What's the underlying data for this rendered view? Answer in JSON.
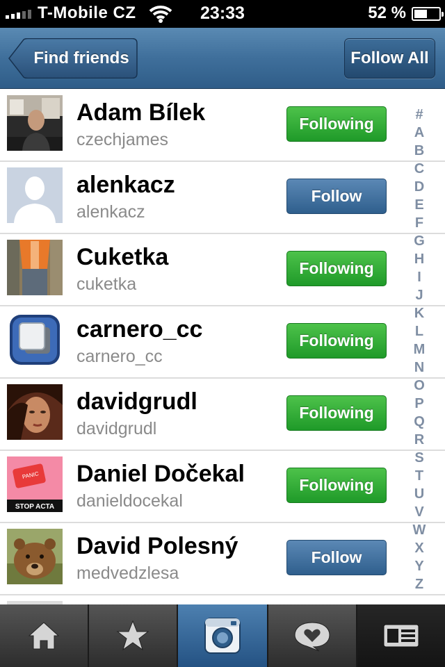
{
  "status": {
    "carrier": "T-Mobile CZ",
    "time": "23:33",
    "battery_text": "52 %",
    "battery_level": 0.52
  },
  "nav": {
    "back_label": "Find friends",
    "follow_all_label": "Follow All"
  },
  "users": [
    {
      "name": "Adam Bílek",
      "username": "czechjames",
      "status": "Following"
    },
    {
      "name": "alenkacz",
      "username": "alenkacz",
      "status": "Follow"
    },
    {
      "name": "Cuketka",
      "username": "cuketka",
      "status": "Following"
    },
    {
      "name": "carnero_cc",
      "username": "carnero_cc",
      "status": "Following"
    },
    {
      "name": "davidgrudl",
      "username": "davidgrudl",
      "status": "Following"
    },
    {
      "name": "Daniel Dočekal",
      "username": "danieldocekal",
      "status": "Following"
    },
    {
      "name": "David Polesný",
      "username": "medvedzlesa",
      "status": "Follow"
    }
  ],
  "avatar_texts": {
    "panic": "PANIC",
    "stop_acta": "STOP ACTA"
  },
  "index_letters": [
    "#",
    "A",
    "B",
    "C",
    "D",
    "E",
    "F",
    "G",
    "H",
    "I",
    "J",
    "K",
    "L",
    "M",
    "N",
    "O",
    "P",
    "Q",
    "R",
    "S",
    "T",
    "U",
    "V",
    "W",
    "X",
    "Y",
    "Z"
  ],
  "tabs": [
    {
      "icon": "home-icon",
      "active": false
    },
    {
      "icon": "star-icon",
      "active": false
    },
    {
      "icon": "camera-icon",
      "active": true
    },
    {
      "icon": "heart-bubble-icon",
      "active": false
    },
    {
      "icon": "profile-card-icon",
      "active": false
    }
  ],
  "colors": {
    "nav_blue": "#3f6f9b",
    "following_green": "#2aa832",
    "follow_blue": "#3f6f9e",
    "index_gray": "#7f8ea3"
  }
}
